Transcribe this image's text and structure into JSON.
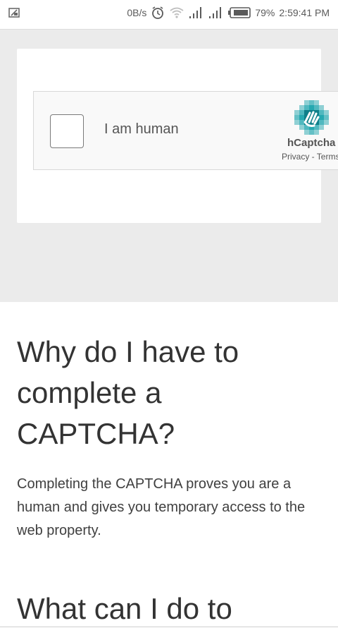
{
  "status_bar": {
    "net_speed": "0B/s",
    "battery_percent": "79%",
    "time": "2:59:41 PM",
    "icons": [
      "cast-icon",
      "alarm-icon",
      "wifi-icon",
      "signal-icon",
      "signal-icon",
      "battery-icon"
    ]
  },
  "captcha": {
    "label": "I am human",
    "brand": "hCaptcha",
    "privacy_link": "Privacy",
    "separator": " - ",
    "terms_link": "Terms",
    "logo_icon": "hcaptcha-hand-icon",
    "colors": {
      "logo_teal": "#25a8b0",
      "logo_dark": "#0f7f8a"
    }
  },
  "content": {
    "heading": "Why do I have to complete a CAPTCHA?",
    "paragraph": "Completing the CAPTCHA proves you are a human and gives you temporary access to the web property.",
    "heading2": "What can I do to"
  }
}
